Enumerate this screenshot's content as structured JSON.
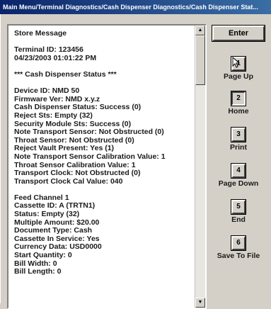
{
  "window": {
    "title": "Main Menu/Terminal Diagnostics/Cash Dispenser Diagnostics/Cash Dispenser Stat..."
  },
  "report": {
    "lines": [
      "Store Message",
      "",
      "Terminal ID: 123456",
      "04/23/2003 01:01:22 PM",
      "",
      "*** Cash Dispenser Status ***",
      "",
      "Device ID: NMD 50",
      "Firmware Ver: NMD x.y.z",
      "Cash Dispenser Status: Success (0)",
      "Reject Sts: Empty (32)",
      "Security Module Sts: Success (0)",
      "Note Transport Sensor: Not Obstructed (0)",
      "Throat Sensor: Not Obstructed (0)",
      "Reject Vault Present: Yes (1)",
      "Note Transport Sensor Calibration Value: 1",
      "Throat Sensor Calibration Value: 1",
      "Transport Clock: Not Obstructed (0)",
      "Transport Clock Cal Value: 040",
      "",
      "Feed Channel 1",
      "Cassette ID: A (TRTN1)",
      "Status: Empty (32)",
      "Multiple Amount: $20.00",
      "Document Type: Cash",
      "Cassette In Service: Yes",
      "Currency Data: USD0000",
      "Start Quantity: 0",
      "Bill Width: 0",
      "Bill Length: 0"
    ]
  },
  "scrollbar": {
    "up_arrow": "▲",
    "down_arrow": "▼"
  },
  "enter_button": {
    "label": "Enter"
  },
  "function_keys": [
    {
      "number": "1",
      "label": "Page Up"
    },
    {
      "number": "2",
      "label": "Home"
    },
    {
      "number": "3",
      "label": "Print"
    },
    {
      "number": "4",
      "label": "Page Down"
    },
    {
      "number": "5",
      "label": "End"
    },
    {
      "number": "6",
      "label": "Save To File"
    }
  ]
}
